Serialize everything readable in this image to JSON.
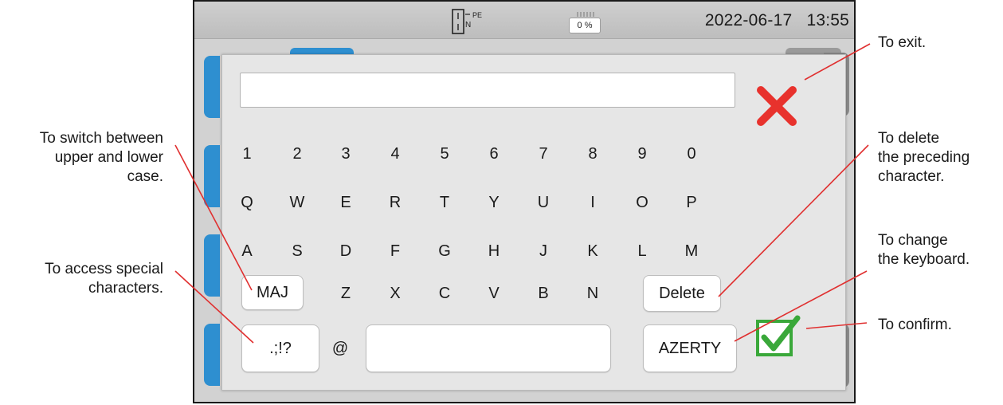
{
  "status_bar": {
    "date": "2022-06-17",
    "time": "13:55",
    "battery_percent": "0 %",
    "connection_label": "PE",
    "connection_n": "N"
  },
  "text_field": {
    "value": ""
  },
  "keyboard": {
    "row_numbers": [
      "1",
      "2",
      "3",
      "4",
      "5",
      "6",
      "7",
      "8",
      "9",
      "0"
    ],
    "row_q": [
      "Q",
      "W",
      "E",
      "R",
      "T",
      "Y",
      "U",
      "I",
      "O",
      "P"
    ],
    "row_a": [
      "A",
      "S",
      "D",
      "F",
      "G",
      "H",
      "J",
      "K",
      "L",
      "M"
    ],
    "row_z": [
      "Z",
      "X",
      "C",
      "V",
      "B",
      "N"
    ],
    "maj_label": "MAJ",
    "delete_label": "Delete",
    "special_label": ".;!?",
    "at_label": "@",
    "azerty_label": "AZERTY",
    "exit_icon": "close-icon",
    "confirm_icon": "checkmark-icon"
  },
  "annotations": {
    "exit": "To exit.",
    "switch_case": "To switch between\nupper and lower\ncase.",
    "delete": "To delete\nthe preceding\ncharacter.",
    "special": "To access special\ncharacters.",
    "change_keyboard": "To change\nthe keyboard.",
    "confirm": "To confirm."
  },
  "colors": {
    "leader_line": "#e03030",
    "exit_red": "#e8322d",
    "confirm_green": "#3aa83a",
    "accent_blue": "#2e8fd0"
  }
}
